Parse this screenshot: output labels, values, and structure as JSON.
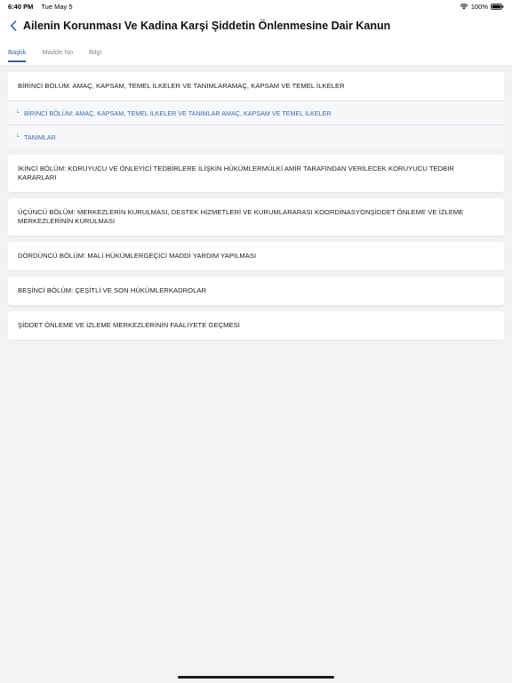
{
  "status": {
    "time": "6:40 PM",
    "date": "Tue May 5",
    "battery": "100%"
  },
  "header": {
    "title": "Ailenin Korunması Ve Kadina Karşi Şiddetin Önlenmesine Dair Kanun",
    "back_icon": "chevron-left-icon"
  },
  "tabs": [
    {
      "label": "Başlık",
      "active": true
    },
    {
      "label": "Madde No",
      "active": false
    },
    {
      "label": "Bilgi",
      "active": false
    }
  ],
  "sections": {
    "s1": {
      "title": "BİRİNCİ BÖLÜM: AMAÇ, KAPSAM, TEMEL İLKELER VE TANIMLARAMAÇ, KAPSAM VE TEMEL İLKELER",
      "children": [
        "BİRİNCİ BÖLÜM: AMAÇ, KAPSAM, TEMEL İLKELER VE TANIMLAR AMAÇ, KAPSAM VE TEMEL İLKELER",
        "TANIMLAR"
      ]
    },
    "s2": "İKİNCİ BÖLÜM: KORUYUCU VE ÖNLEYİCİ TEDBİRLERE İLİŞKİN HÜKÜMLERMÜLKİ AMİR TARAFINDAN VERİLECEK KORUYUCU TEDBİR KARARLARI",
    "s3": "ÜÇÜNCÜ BÖLÜM: MERKEZLERİN KURULMASI, DESTEK HİZMETLERİ VE KURUMLARARASI KOORDİNASYONŞİDDET ÖNLEME VE İZLEME MERKEZLERİNİN KURULMASI",
    "s4": "DÖRDÜNCÜ BÖLÜM: MALİ HÜKÜMLERGEÇİCİ MADDİ YARDIM YAPILMASI",
    "s5": "BEŞİNCİ BÖLÜM: ÇEŞİTLİ VE SON HÜKÜMLERKADROLAR",
    "s6": "ŞİDDET ÖNLEME VE İZLEME MERKEZLERİNİN FAALİYETE GEÇMESİ"
  },
  "colors": {
    "accent": "#2f5fa8",
    "background": "#f2f2f5"
  }
}
